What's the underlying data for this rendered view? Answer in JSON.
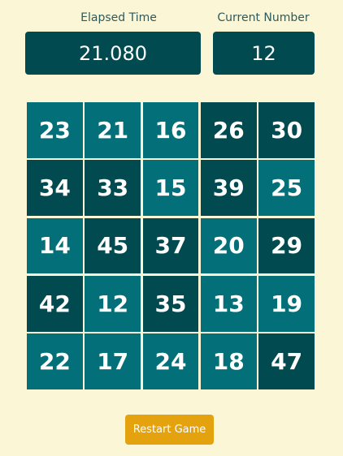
{
  "header": {
    "elapsed_label": "Elapsed Time",
    "elapsed_value": "21.080",
    "current_label": "Current Number",
    "current_value": "12"
  },
  "grid": {
    "cells": [
      {
        "n": "23",
        "shade": "light"
      },
      {
        "n": "21",
        "shade": "light"
      },
      {
        "n": "16",
        "shade": "light"
      },
      {
        "n": "26",
        "shade": "dark"
      },
      {
        "n": "30",
        "shade": "dark"
      },
      {
        "n": "34",
        "shade": "dark"
      },
      {
        "n": "33",
        "shade": "dark"
      },
      {
        "n": "15",
        "shade": "light"
      },
      {
        "n": "39",
        "shade": "dark"
      },
      {
        "n": "25",
        "shade": "light"
      },
      {
        "n": "14",
        "shade": "light"
      },
      {
        "n": "45",
        "shade": "dark"
      },
      {
        "n": "37",
        "shade": "dark"
      },
      {
        "n": "20",
        "shade": "light"
      },
      {
        "n": "29",
        "shade": "dark"
      },
      {
        "n": "42",
        "shade": "dark"
      },
      {
        "n": "12",
        "shade": "light"
      },
      {
        "n": "35",
        "shade": "dark"
      },
      {
        "n": "13",
        "shade": "light"
      },
      {
        "n": "19",
        "shade": "light"
      },
      {
        "n": "22",
        "shade": "light"
      },
      {
        "n": "17",
        "shade": "light"
      },
      {
        "n": "24",
        "shade": "light"
      },
      {
        "n": "18",
        "shade": "light"
      },
      {
        "n": "47",
        "shade": "dark"
      }
    ]
  },
  "restart_label": "Restart Game",
  "colors": {
    "background": "#FAF6D6",
    "dark": "#004A50",
    "light": "#036F78",
    "button": "#E3A20E"
  }
}
